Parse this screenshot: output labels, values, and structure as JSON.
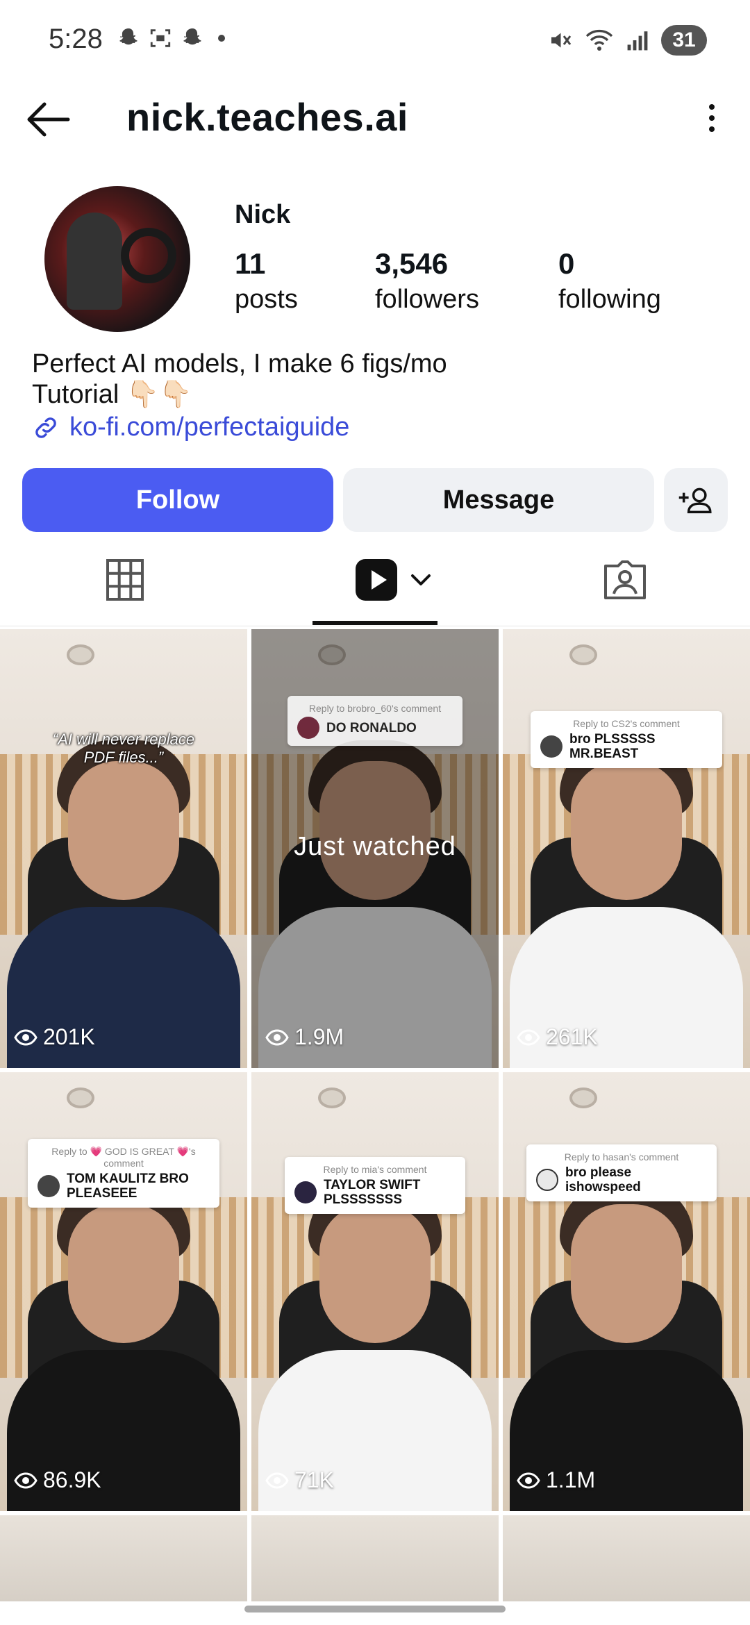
{
  "status_bar": {
    "time": "5:28",
    "battery": "31"
  },
  "header": {
    "username": "nick.teaches.ai"
  },
  "profile": {
    "display_name": "Nick",
    "posts": {
      "count": "11",
      "label": "posts"
    },
    "followers": {
      "count": "3,546",
      "label": "followers"
    },
    "following": {
      "count": "0",
      "label": "following"
    },
    "bio_line1": "Perfect AI models, I make 6 figs/mo",
    "bio_line2": "Tutorial 👇🏻👇🏻",
    "link": "ko-fi.com/perfectaiguide"
  },
  "actions": {
    "follow": "Follow",
    "message": "Message"
  },
  "colors": {
    "accent": "#4b5cf2",
    "link": "#3a4bd8"
  },
  "tabs": [
    "grid-icon",
    "reels-icon",
    "tagged-icon"
  ],
  "reels": [
    {
      "views": "201K",
      "overlay": "“AI will never replace PDF files...”",
      "shirt": "#1e2a47"
    },
    {
      "views": "1.9M",
      "label": "Just watched",
      "reply_to": "Reply to brobro_60's comment",
      "reply_text": "DO RONALDO",
      "shirt": "#f2f2f2"
    },
    {
      "views": "261K",
      "reply_to": "Reply to CS2's comment",
      "reply_text": "bro PLSSSSS MR.BEAST",
      "shirt": "#f4f4f4"
    },
    {
      "views": "86.9K",
      "reply_to": "Reply to 💗 GOD IS GREAT 💗's comment",
      "reply_text": "TOM KAULITZ BRO PLEASEEE",
      "shirt": "#151515"
    },
    {
      "views": "71K",
      "reply_to": "Reply to mia's comment",
      "reply_text": "TAYLOR SWIFT PLSSSSSSS",
      "shirt": "#f4f4f4"
    },
    {
      "views": "1.1M",
      "reply_to": "Reply to hasan's comment",
      "reply_text": "bro please ishowspeed",
      "shirt": "#151515"
    }
  ]
}
